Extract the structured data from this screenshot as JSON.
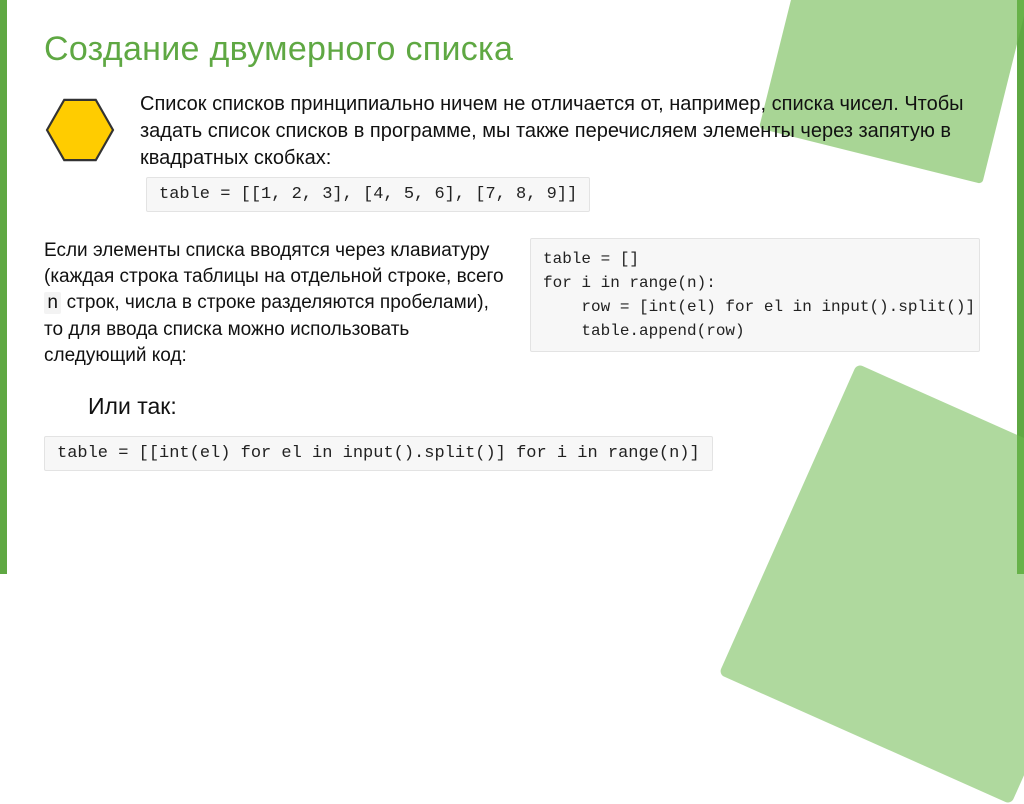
{
  "title": "Создание двумерного списка",
  "intro": "Список списков принципиально ничем не отличается от, например, списка чисел. Чтобы задать список списков в программе, мы также перечисляем элементы через запятую в квадратных скобках:",
  "code1": "table = [[1, 2, 3], [4, 5, 6], [7, 8, 9]]",
  "mid_text_1": "Если элементы списка вводятся через клавиатуру (каждая строка таблицы на отдельной строке, всего ",
  "mid_mono": "n",
  "mid_text_2": " строк, числа в строке разделяются пробелами), то для ввода списка можно использовать следующий код:",
  "code2": "table = []\nfor i in range(n):\n    row = [int(el) for el in input().split()]\n    table.append(row)",
  "or_label": "Или так:",
  "code3": "table = [[int(el) for el in input().split()] for i in range(n)]",
  "icon": {
    "name": "hexagon-icon",
    "fill": "#ffcc00",
    "stroke": "#333333"
  }
}
